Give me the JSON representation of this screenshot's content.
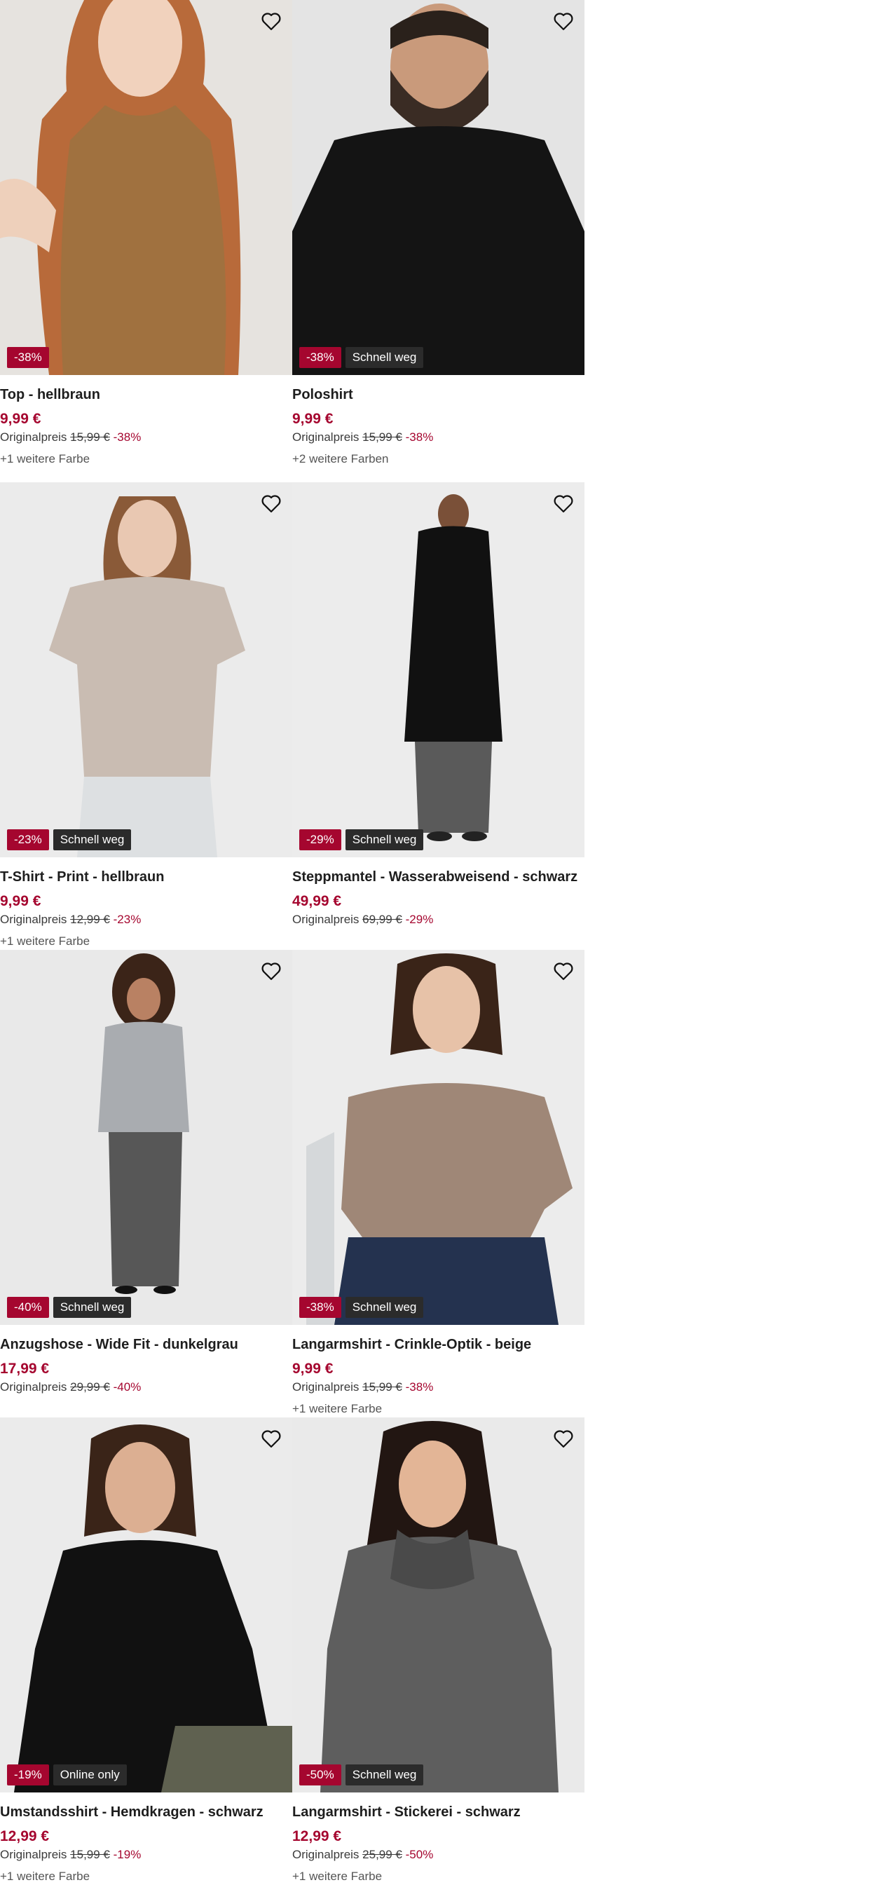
{
  "colors": {
    "accent": "#a5062f",
    "flag_bg": "#2b2b2b"
  },
  "labels": {
    "original_price": "Originalpreis"
  },
  "products": [
    {
      "title": "Top - hellbraun",
      "price": "9,99 €",
      "original_price": "15,99 €",
      "discount": "-38%",
      "flag": "",
      "more_colors": "+1 weitere Farbe"
    },
    {
      "title": "Poloshirt",
      "price": "9,99 €",
      "original_price": "15,99 €",
      "discount": "-38%",
      "flag": "Schnell weg",
      "more_colors": "+2 weitere Farben"
    },
    {
      "title": "T-Shirt - Print - hellbraun",
      "price": "9,99 €",
      "original_price": "12,99 €",
      "discount": "-23%",
      "flag": "Schnell weg",
      "more_colors": "+1 weitere Farbe"
    },
    {
      "title": "Steppmantel - Wasserabweisend - schwarz",
      "price": "49,99 €",
      "original_price": "69,99 €",
      "discount": "-29%",
      "flag": "Schnell weg",
      "more_colors": ""
    },
    {
      "title": "Anzugshose - Wide Fit - dunkelgrau",
      "price": "17,99 €",
      "original_price": "29,99 €",
      "discount": "-40%",
      "flag": "Schnell weg",
      "more_colors": ""
    },
    {
      "title": "Langarmshirt - Crinkle-Optik - beige",
      "price": "9,99 €",
      "original_price": "15,99 €",
      "discount": "-38%",
      "flag": "Schnell weg",
      "more_colors": "+1 weitere Farbe"
    },
    {
      "title": "Umstandsshirt - Hemdkragen - schwarz",
      "price": "12,99 €",
      "original_price": "15,99 €",
      "discount": "-19%",
      "flag": "Online only",
      "more_colors": "+1 weitere Farbe"
    },
    {
      "title": "Langarmshirt - Stickerei - schwarz",
      "price": "12,99 €",
      "original_price": "25,99 €",
      "discount": "-50%",
      "flag": "Schnell weg",
      "more_colors": "+1 weitere Farbe"
    }
  ]
}
